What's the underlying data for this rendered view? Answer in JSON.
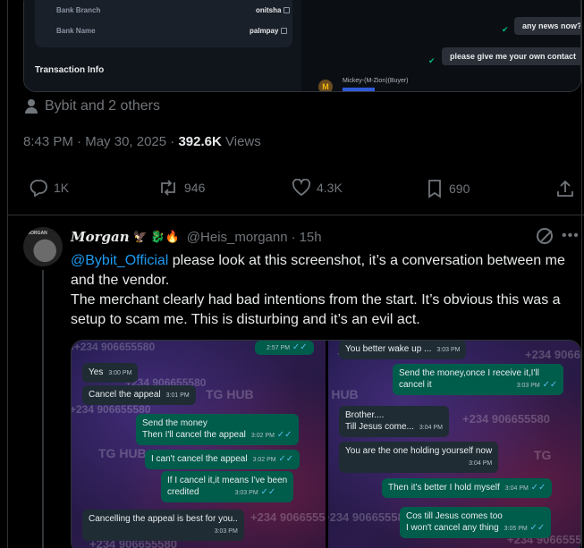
{
  "top_image": {
    "bank_branch_label": "Bank Branch",
    "bank_branch_value": "onitsha",
    "bank_name_label": "Bank Name",
    "bank_name_value": "palmpay",
    "transaction_info": "Transaction Info",
    "msg_any_news": "any news now?",
    "msg_contact": "please give me your own contact",
    "buyer_initial": "M",
    "buyer_name": "Mickey-(M-Zion)(Buyer)"
  },
  "tweet": {
    "reposted_by": "Bybit and 2 others",
    "time": "8:43 PM",
    "date": "May 30, 2025",
    "views_count": "392.6K",
    "views_label": "Views",
    "replies": "1K",
    "reposts": "946",
    "likes": "4.3K",
    "bookmarks": "690"
  },
  "reply": {
    "name": "Morgan",
    "name_emojis": "🦅 🐉🔥",
    "handle": "@Heis_morgann",
    "age": "15h",
    "avatar_text": "MORGAN",
    "mention": "@Bybit_Official",
    "text_1": " please look at this screenshot, it’s a conversation between me and the vendor.",
    "text_2": "The merchant clearly had bad intentions from the start. It’s obvious this was a setup to scam me. This is disturbing and it’s an evil act."
  },
  "chat_left": {
    "top_time": "2:57 PM",
    "m1": "Yes",
    "m1_t": "3:00 PM",
    "m2": "Cancel the appeal",
    "m2_t": "3:01 PM",
    "m3a": "Send the money",
    "m3b": "Then I'll cancel the appeal",
    "m3_t": "3:02 PM",
    "m4": "I can't cancel the appeal",
    "m4_t": "3:02 PM",
    "m5a": "If I cancel it,it means I've been",
    "m5b": "credited",
    "m5_t": "3:03 PM",
    "m6": "Cancelling the appeal is best for you..",
    "m6_t": "3:03 PM"
  },
  "chat_right": {
    "m1": "You better wake up ...",
    "m1_t": "3:03 PM",
    "m2a": "Send the money,once I receive it,I'll",
    "m2b": "cancel it",
    "m2_t": "3:03 PM",
    "m3a": "Brother....",
    "m3b": "Till Jesus come...",
    "m3_t": "3:04 PM",
    "m4": "You are the one holding yourself now",
    "m4_t": "3:04 PM",
    "m5": "Then it's better I hold myself",
    "m5_t": "3:04 PM",
    "m6a": "Cos till Jesus comes too",
    "m6b": "I won't cancel any thing",
    "m6_t": "3:05 PM"
  },
  "watermark": {
    "tg_hub": "TG HUB",
    "phone": "+234 906655580",
    "short": "TG"
  },
  "colors": {
    "background": "#000000",
    "text_secondary": "#71767b",
    "link": "#1d9bf0",
    "chat_out": "#005c4b",
    "chat_in": "#1f2c34"
  }
}
